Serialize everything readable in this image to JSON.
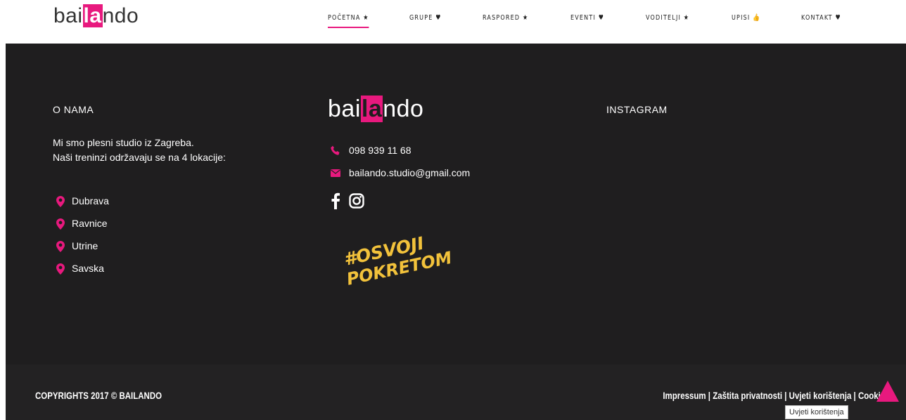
{
  "header": {
    "logo_pre": "bai",
    "logo_accent": "la",
    "logo_post": "ndo",
    "nav": [
      {
        "label": "POČETNA ★",
        "active": true
      },
      {
        "label": "GRUPE ♥",
        "active": false
      },
      {
        "label": "RASPORED ★",
        "active": false
      },
      {
        "label": "EVENTI ♥",
        "active": false
      },
      {
        "label": "VODITELJI ★",
        "active": false
      },
      {
        "label": "UPISI 👍",
        "active": false
      },
      {
        "label": "KONTAKT ♥",
        "active": false
      }
    ]
  },
  "about": {
    "title": "O NAMA",
    "line1": "Mi smo plesni studio iz Zagreba.",
    "line2": "Naši treninzi održavaju se na 4 lokacije:",
    "locations": [
      "Dubrava",
      "Ravnice",
      "Utrine",
      "Savska"
    ]
  },
  "contact": {
    "logo_pre": "bai",
    "logo_accent": "la",
    "logo_post": "ndo",
    "phone": "098 939 11 68",
    "email": "bailando.studio@gmail.com",
    "slogan_line1": "#OSVOJI",
    "slogan_line2": "POKRETOM"
  },
  "instagram": {
    "title": "INSTAGRAM"
  },
  "bottom": {
    "copyright": "COPYRIGHTS 2017 © BAILANDO",
    "links": [
      "Impressum",
      "Zaštita privatnosti",
      "Uvjeti korištenja",
      "Cookie"
    ],
    "separator": " | ",
    "tooltip": "Uvjeti korištenja"
  },
  "colors": {
    "accent": "#e8197e",
    "dark_bg": "#1f1e1f",
    "slogan": "#f2c23b"
  },
  "icons": [
    "phone-icon",
    "envelope-icon",
    "map-pin-icon",
    "facebook-icon",
    "instagram-icon",
    "arrow-up-icon"
  ]
}
